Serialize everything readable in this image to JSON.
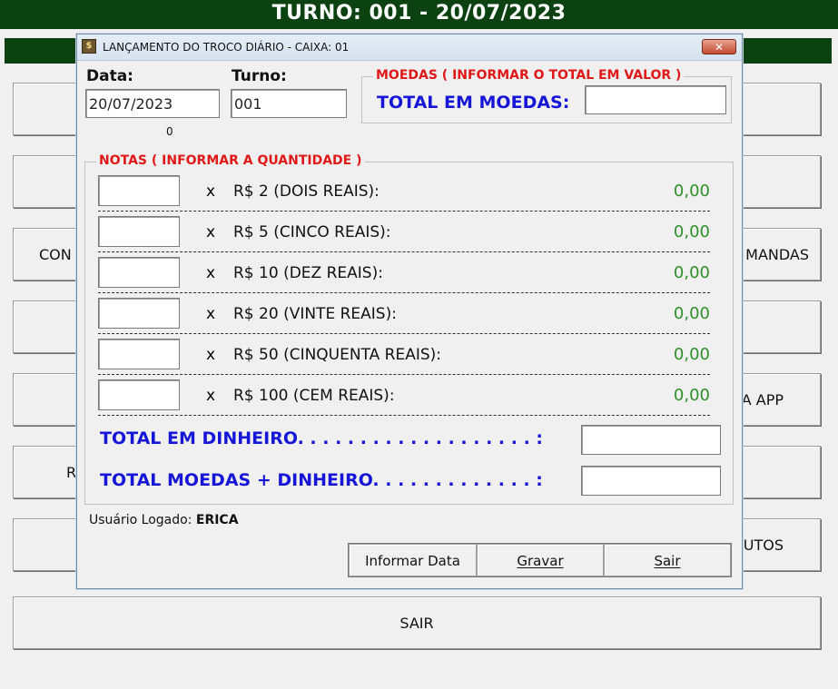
{
  "header": {
    "title": "TURNO: 001 - 20/07/2023"
  },
  "background_buttons": [
    {
      "left": "",
      "right": "",
      "center": ""
    },
    {
      "left": "",
      "right": "",
      "center": ""
    },
    {
      "left": "CON",
      "right": "MANDAS",
      "center": ""
    },
    {
      "left": "",
      "right": "",
      "center": ""
    },
    {
      "left": "",
      "right": "A APP",
      "center": ""
    },
    {
      "left": "R",
      "right": "",
      "center": ""
    },
    {
      "left": "",
      "right": "UTOS",
      "center": ""
    },
    {
      "left": "",
      "right": "",
      "center": "SAIR"
    }
  ],
  "dialog": {
    "title": "LANÇAMENTO DO TROCO DIÁRIO - CAIXA: 01",
    "close_glyph": "✕",
    "icon_glyph": "$",
    "data_label": "Data:",
    "data_value": "20/07/2023",
    "turno_label": "Turno:",
    "turno_value": "001",
    "zero_label": "0",
    "moedas_group": "MOEDAS ( INFORMAR O TOTAL EM VALOR )",
    "total_moedas_label": "TOTAL EM MOEDAS:",
    "total_moedas_value": "",
    "notas_group": "NOTAS ( INFORMAR A QUANTIDADE )",
    "notes": [
      {
        "qty": "",
        "x": "x",
        "desc": "R$ 2 (DOIS REAIS):",
        "value": "0,00"
      },
      {
        "qty": "",
        "x": "x",
        "desc": "R$ 5 (CINCO REAIS):",
        "value": "0,00"
      },
      {
        "qty": "",
        "x": "x",
        "desc": "R$ 10 (DEZ REAIS):",
        "value": "0,00"
      },
      {
        "qty": "",
        "x": "x",
        "desc": "R$ 20 (VINTE REAIS):",
        "value": "0,00"
      },
      {
        "qty": "",
        "x": "x",
        "desc": "R$ 50 (CINQUENTA REAIS):",
        "value": "0,00"
      },
      {
        "qty": "",
        "x": "x",
        "desc": "R$ 100 (CEM REAIS):",
        "value": "0,00"
      }
    ],
    "total_dinheiro_label": "TOTAL EM DINHEIRO. . . . . . . . . . . . . . . . . . . :",
    "total_dinheiro_value": "",
    "total_geral_label": "TOTAL MOEDAS + DINHEIRO. . . . . . . . . . . . . :",
    "total_geral_value": "",
    "user_prefix": "Usuário Logado:",
    "user_name": "ERICA",
    "buttons": {
      "informar_data": "Informar Data",
      "gravar": "Gravar",
      "sair": "Sair"
    }
  },
  "colors": {
    "header_green": "#0c4212",
    "label_red": "#e01818",
    "label_blue": "#1616d8",
    "value_green": "#2f8f2a"
  }
}
